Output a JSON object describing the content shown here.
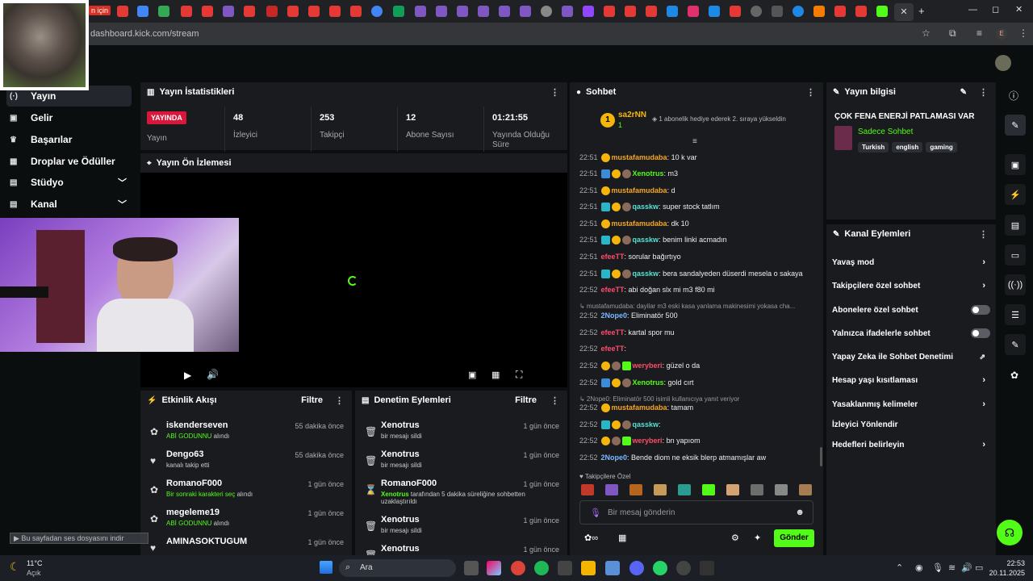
{
  "browser": {
    "tab_fragment": "n için",
    "url": "dashboard.kick.com/stream",
    "profile_letter": "E"
  },
  "sidebar": {
    "items": [
      {
        "label": "Yayın",
        "icon": "broadcast-icon"
      },
      {
        "label": "Gelir",
        "icon": "money-icon"
      },
      {
        "label": "Başarılar",
        "icon": "trophy-icon"
      },
      {
        "label": "Droplar ve Ödüller",
        "icon": "gift-icon"
      },
      {
        "label": "Stüdyo",
        "icon": "layout-icon"
      },
      {
        "label": "Kanal",
        "icon": "layout-icon"
      }
    ]
  },
  "stats": {
    "title": "Yayın İstatistikleri",
    "live_badge": "YAYINDA",
    "live_label": "Yayın",
    "viewers_value": "48",
    "viewers_label": "İzleyici",
    "followers_value": "253",
    "followers_label": "Takipçi",
    "subs_value": "12",
    "subs_label": "Abone Sayısı",
    "uptime_value": "01:21:55",
    "uptime_label": "Yayında Olduğu Süre"
  },
  "preview": {
    "title": "Yayın Ön İzlemesi"
  },
  "activity": {
    "title": "Etkinlik Akışı",
    "filter": "Filtre",
    "rows": [
      {
        "name": "iskenderseven",
        "sub_highlight": "ABİ GODUNNU",
        "sub_rest": " alındı",
        "time": "55 dakika önce"
      },
      {
        "name": "Dengo63",
        "sub_highlight": "",
        "sub_rest": "kanalı takip etti",
        "time": "55 dakika önce"
      },
      {
        "name": "RomanoF000",
        "sub_highlight": "Bir sonraki karakteri seç",
        "sub_rest": " alındı",
        "time": "1 gün önce"
      },
      {
        "name": "megeleme19",
        "sub_highlight": "ABİ GODUNNU",
        "sub_rest": " alındı",
        "time": "1 gün önce"
      },
      {
        "name": "AMINASOKTUGUM",
        "sub_highlight": "",
        "sub_rest": "",
        "time": "1 gün önce"
      }
    ]
  },
  "moderation": {
    "title": "Denetim Eylemleri",
    "filter": "Filtre",
    "rows": [
      {
        "name": "Xenotrus",
        "sub_highlight": "",
        "sub_rest": "bir mesajı sildi",
        "time": "1 gün önce"
      },
      {
        "name": "Xenotrus",
        "sub_highlight": "",
        "sub_rest": "bir mesajı sildi",
        "time": "1 gün önce"
      },
      {
        "name": "RomanoF000",
        "sub_highlight": "Xenotrus",
        "sub_rest": " tarafından 5 dakika süreliğine sohbetten",
        "sub_line2": "uzaklaştırıldı",
        "time": "1 gün önce"
      },
      {
        "name": "Xenotrus",
        "sub_highlight": "",
        "sub_rest": "bir mesajı sildi",
        "time": "1 gün önce"
      },
      {
        "name": "Xenotrus",
        "sub_highlight": "",
        "sub_rest": "",
        "time": "1 gün önce"
      }
    ]
  },
  "chat": {
    "title": "Sohbet",
    "pinned_user": "sa2rNN",
    "pinned_count": "1",
    "pinned_text": "1 abonelik hediye ederek 2. sıraya yükseldin",
    "messages": [
      {
        "time": "22:51",
        "user": "mustafamudaba",
        "cls": "uo",
        "badges": [
          "bgold"
        ],
        "text": ": 10 k var"
      },
      {
        "time": "22:51",
        "user": "Xenotrus",
        "cls": "ug",
        "badges": [
          "bblue",
          "bgold",
          "bgray"
        ],
        "text": ": m3"
      },
      {
        "time": "22:51",
        "user": "mustafamudaba",
        "cls": "uo",
        "badges": [
          "bgold"
        ],
        "text": ": d"
      },
      {
        "time": "22:51",
        "user": "qasskw",
        "cls": "ut",
        "badges": [
          "bteal",
          "bgold",
          "bgray"
        ],
        "text": ": super stock tatlım"
      },
      {
        "time": "22:51",
        "user": "mustafamudaba",
        "cls": "uo",
        "badges": [
          "bgold"
        ],
        "text": ": dk 10"
      },
      {
        "time": "22:51",
        "user": "qasskw",
        "cls": "ut",
        "badges": [
          "bteal",
          "bgold",
          "bgray"
        ],
        "text": ": benim linki acmadın"
      },
      {
        "time": "22:51",
        "user": "efeeTT",
        "cls": "ur",
        "badges": [],
        "text": ": sorular bağırtıyo"
      },
      {
        "time": "22:51",
        "user": "qasskw",
        "cls": "ut",
        "badges": [
          "bteal",
          "bgold",
          "bgray"
        ],
        "text": ": bera sandalyeden düserdi mesela o sakaya"
      },
      {
        "time": "22:52",
        "user": "efeeTT",
        "cls": "ur",
        "badges": [],
        "text": ": abi doğan slx mi m3 f80 mi"
      },
      {
        "time": "",
        "user": "",
        "cls": "reply",
        "badges": [],
        "text": "↳ mustafamudaba: dayilar m3 eski kasa yanlama makinesimi yokasa cha..."
      },
      {
        "time": "22:52",
        "user": "2Nope0",
        "cls": "ub",
        "badges": [],
        "text": ": Eliminatör 500"
      },
      {
        "time": "22:52",
        "user": "efeeTT",
        "cls": "ur",
        "badges": [],
        "text": ": kartal spor mu"
      },
      {
        "time": "22:52",
        "user": "efeeTT",
        "cls": "ur",
        "badges": [],
        "text": ":"
      },
      {
        "time": "22:52",
        "user": "weryberi",
        "cls": "ur",
        "badges": [
          "bgold",
          "bgray",
          "bgreen"
        ],
        "text": ": güzel o da"
      },
      {
        "time": "22:52",
        "user": "Xenotrus",
        "cls": "ug",
        "badges": [
          "bblue",
          "bgold",
          "bgray"
        ],
        "text": ": gold cırt"
      },
      {
        "time": "",
        "user": "",
        "cls": "reply",
        "badges": [],
        "text": "↳ 2Nope0: Eliminatör 500 isimli kullanıcıya yanıt veriyor"
      },
      {
        "time": "22:52",
        "user": "mustafamudaba",
        "cls": "uo",
        "badges": [
          "bgold"
        ],
        "text": ": tamam"
      },
      {
        "time": "22:52",
        "user": "qasskw",
        "cls": "ut",
        "badges": [
          "bteal",
          "bgold",
          "bgray"
        ],
        "text": ":"
      },
      {
        "time": "22:52",
        "user": "weryberi",
        "cls": "ur",
        "badges": [
          "bgold",
          "bgray",
          "bgreen"
        ],
        "text": ": bn yapıom"
      },
      {
        "time": "22:52",
        "user": "2Nope0",
        "cls": "ub",
        "badges": [],
        "text": ": Bende diom ne eksik blerp atmamışlar aw"
      }
    ],
    "followers_only": "Takipçilere Özel",
    "input_placeholder": "Bir mesaj gönderin",
    "send": "Gönder"
  },
  "stream_info": {
    "title": "Yayın bilgisi",
    "stream_title": "ÇOK FENA ENERJİ PATLAMASI VAR",
    "category": "Sadece Sohbet",
    "tags": [
      "Turkish",
      "english",
      "gaming"
    ]
  },
  "channel_actions": {
    "title": "Kanal Eylemleri",
    "items": [
      {
        "label": "Yavaş mod",
        "kind": "chevron"
      },
      {
        "label": "Takipçilere özel sohbet",
        "kind": "chevron"
      },
      {
        "label": "Abonelere özel sohbet",
        "kind": "toggle"
      },
      {
        "label": "Yalnızca ifadelerle sohbet",
        "kind": "toggle"
      },
      {
        "label": "Yapay Zeka ile Sohbet Denetimi",
        "kind": "external"
      },
      {
        "label": "Hesap yaşı kısıtlaması",
        "kind": "chevron"
      },
      {
        "label": "Yasaklanmış kelimeler",
        "kind": "chevron"
      },
      {
        "label": "İzleyici Yönlendir",
        "kind": "none"
      },
      {
        "label": "Hedefleri belirleyin",
        "kind": "chevron"
      }
    ]
  },
  "overlay_toast": "Bu sayfadan ses dosyasını indir",
  "taskbar": {
    "weather_temp": "11°C",
    "weather_desc": "Açık",
    "search": "Ara",
    "time": "22:53",
    "date": "20.11.2025"
  },
  "colors": {
    "accent": "#53fc18",
    "live": "#d9173b",
    "panel": "#191b1f"
  }
}
